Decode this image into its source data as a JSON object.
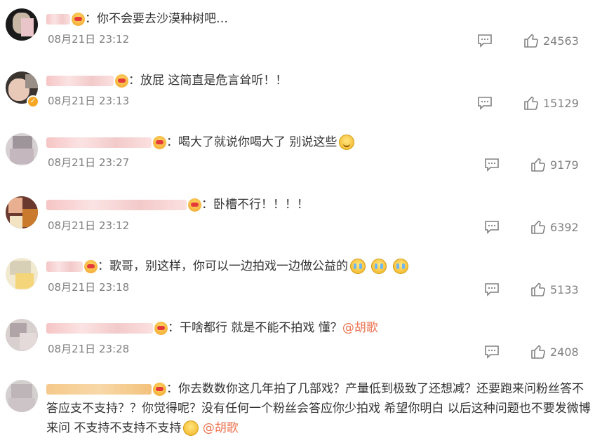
{
  "comments": [
    {
      "text": "你不会要去沙漠种树吧…",
      "time": "08月21日 23:12",
      "likes": "24563"
    },
    {
      "text": "放屁 这简直是危言耸听！！",
      "time": "08月21日 23:13",
      "likes": "15129"
    },
    {
      "text": "喝大了就说你喝大了 别说这些",
      "time": "08月21日 23:27",
      "likes": "9179"
    },
    {
      "text": "卧槽不行！！！！",
      "time": "08月21日 23:12",
      "likes": "6392"
    },
    {
      "text": "歌哥，别这样，你可以一边拍戏一边做公益的",
      "time": "08月21日 23:18",
      "likes": "5133"
    },
    {
      "text": "干啥都行 就是不能不拍戏 懂？",
      "mention": "@胡歌",
      "time": "08月21日 23:28",
      "likes": "2408"
    },
    {
      "text_line1": "你去数数你这几年拍了几部戏？产量低到极致了还想减？还要跑来问粉丝答不",
      "text_line2": "答应支不支持？？你觉得呢？没有任何一个粉丝会答应你少拍戏 希望你明白 以后这种问题也不要发微博",
      "text_line3": "来问 不支持不支持不支持",
      "mention": "@胡歌"
    }
  ],
  "separator": "：",
  "icons": {
    "reply": "comment-reply-icon",
    "like": "thumbs-up-icon"
  },
  "colors": {
    "mention": "#eb7350",
    "meta": "#808080",
    "text": "#333333"
  }
}
